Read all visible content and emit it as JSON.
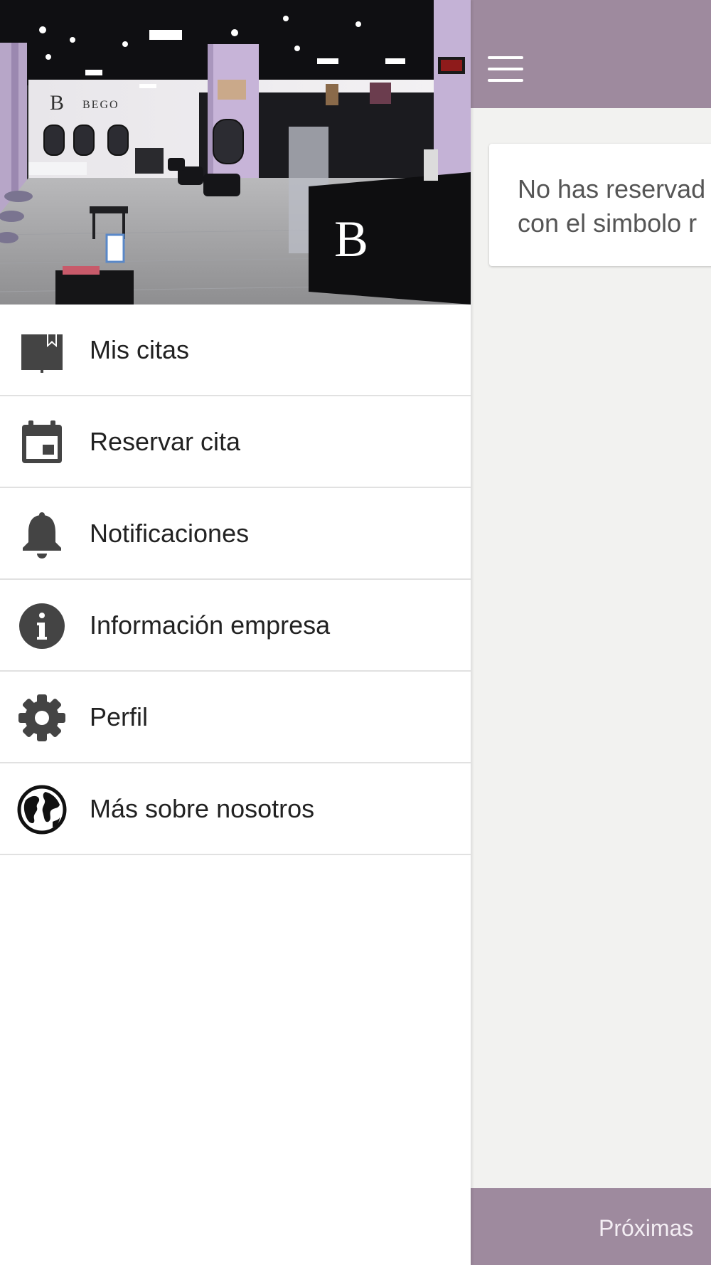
{
  "theme": {
    "bar_color": "#9e8a9e",
    "icon_color": "#444444",
    "text_color": "#222222"
  },
  "main": {
    "empty_message": "No has reservad\ncon el simbolo r",
    "bottom_tab": "Próximas"
  },
  "drawer": {
    "header_image": {
      "logo_letter": "B",
      "logo_name": "BEGO"
    },
    "items": [
      {
        "label": "Mis citas",
        "icon": "book-icon"
      },
      {
        "label": "Reservar cita",
        "icon": "calendar-icon"
      },
      {
        "label": "Notificaciones",
        "icon": "bell-icon"
      },
      {
        "label": "Información empresa",
        "icon": "info-icon"
      },
      {
        "label": "Perfil",
        "icon": "gear-icon"
      },
      {
        "label": "Más sobre nosotros",
        "icon": "globe-icon"
      }
    ]
  }
}
